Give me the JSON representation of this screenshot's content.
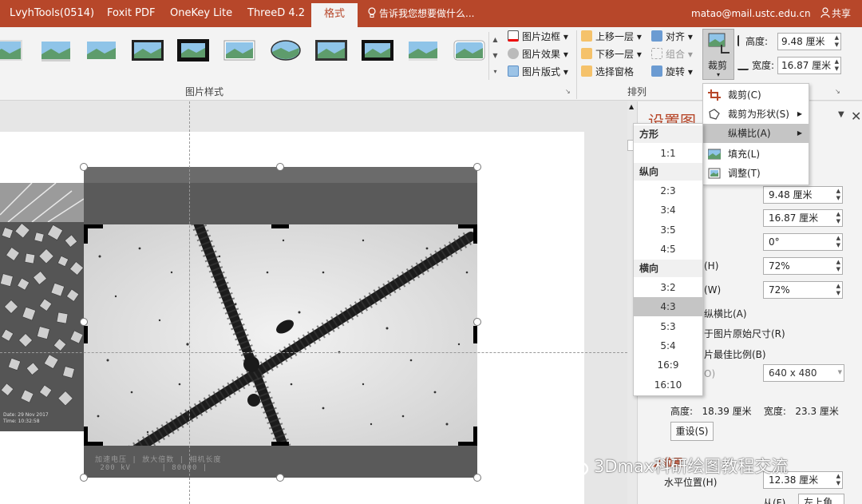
{
  "tabs": [
    {
      "label": "LvyhTools(0514)",
      "active": false
    },
    {
      "label": "Foxit PDF",
      "active": false
    },
    {
      "label": "OneKey Lite",
      "active": false
    },
    {
      "label": "ThreeD 4.2",
      "active": false
    },
    {
      "label": "格式",
      "active": true
    }
  ],
  "tell_me": "告诉我您想要做什么...",
  "account": "matao@mail.ustc.edu.cn",
  "share": "共享",
  "ribbon": {
    "picture_styles_group": "图片样式",
    "border": "图片边框",
    "effects": "图片效果",
    "layout": "图片版式",
    "bring_forward": "上移一层",
    "send_backward": "下移一层",
    "selection_pane": "选择窗格",
    "align": "对齐",
    "group": "组合",
    "rotate": "旋转",
    "arrange_group": "排列",
    "crop": "裁剪",
    "height_label": "高度:",
    "height_value": "9.48 厘米",
    "width_label": "宽度:",
    "width_value": "16.87 厘米"
  },
  "crop_menu": [
    {
      "label": "裁剪(C)",
      "highlighted": false,
      "submenu": false,
      "icon": "crop-icon"
    },
    {
      "label": "裁剪为形状(S)",
      "highlighted": false,
      "submenu": true,
      "icon": "crop-to-shape-icon"
    },
    {
      "label": "纵横比(A)",
      "highlighted": true,
      "submenu": true,
      "icon": ""
    },
    {
      "label": "填充(L)",
      "highlighted": false,
      "submenu": false,
      "icon": "fill-icon"
    },
    {
      "label": "调整(T)",
      "highlighted": false,
      "submenu": false,
      "icon": "fit-icon"
    }
  ],
  "aspect_menu": {
    "square_header": "方形",
    "square": [
      "1:1"
    ],
    "portrait_header": "纵向",
    "portrait": [
      "2:3",
      "3:4",
      "3:5",
      "4:5"
    ],
    "landscape_header": "横向",
    "landscape": [
      "3:2",
      "4:3",
      "5:3",
      "5:4",
      "16:9",
      "16:10"
    ],
    "selected": "4:3"
  },
  "pane": {
    "title": "设置图",
    "height_value": "9.48 厘米",
    "width_value": "16.87 厘米",
    "rotation_value": "0°",
    "scale_h_label": "(H)",
    "scale_h_value": "72%",
    "scale_w_label": "(W)",
    "scale_w_value": "72%",
    "lock_aspect": "纵横比(A)",
    "relative_original": "于图片原始尺寸(R)",
    "best_scale": "片最佳比例(B)",
    "resolution_label": "O)",
    "resolution_value": "640 x 480",
    "original_size": "高度:   18.39 厘米    宽度:   23.3 厘米",
    "reset": "重设(S)",
    "position_header": "位置",
    "h_position_label": "水平位置(H)",
    "h_position_value": "12.38 厘米",
    "from_label": "从(F)",
    "from_value": "左上角"
  },
  "image": {
    "sem_caption": "Date: 29 Nov 2017\nTime: 10:32:58",
    "scale_bar_text": "加速电压 | 放大倍数 | 相机长度\n 200 kV      | 80000 |"
  },
  "watermark": "3Dmax科研绘图教程交流"
}
